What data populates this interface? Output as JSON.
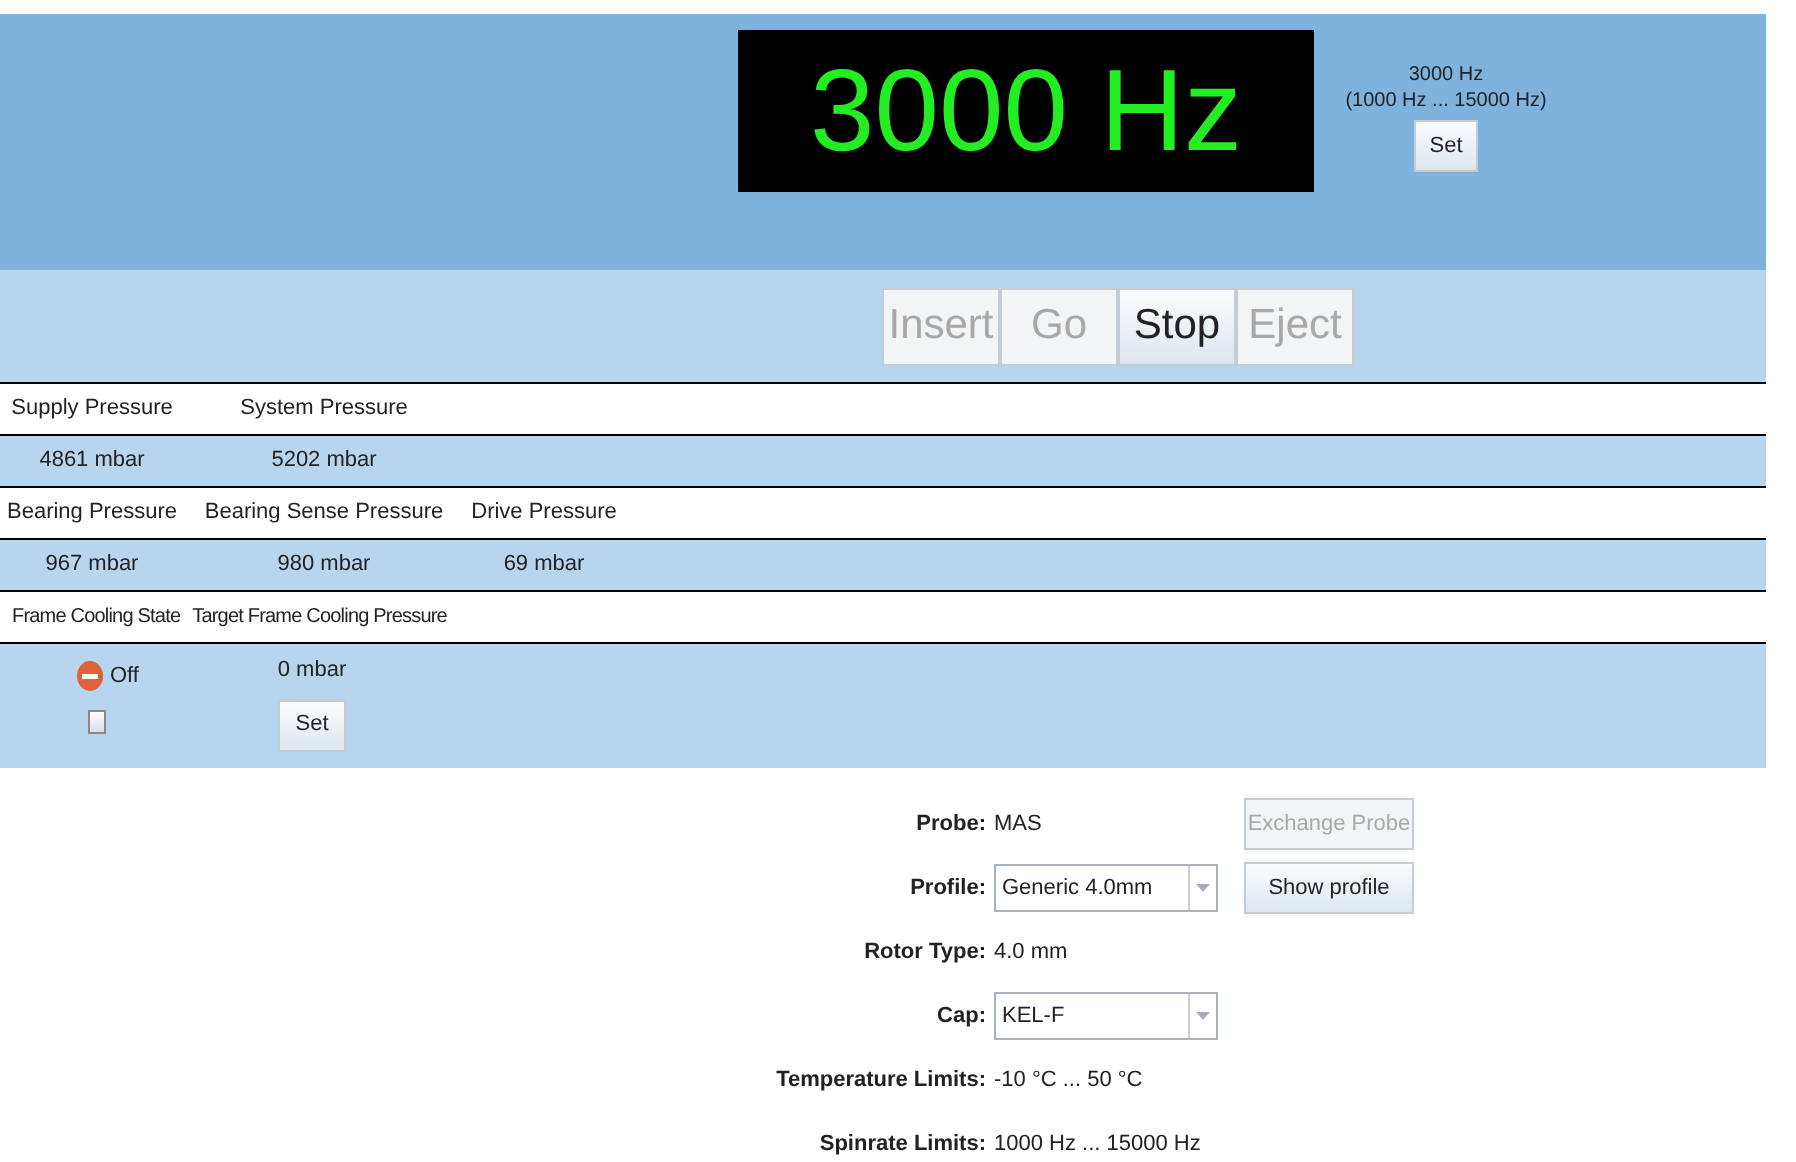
{
  "display": {
    "reading": "3000 Hz"
  },
  "setpoint": {
    "value": "3000 Hz",
    "range": "(1000 Hz ... 15000 Hz)",
    "button": "Set"
  },
  "controls": [
    {
      "label": "Insert",
      "disabled": true
    },
    {
      "label": "Go",
      "disabled": true
    },
    {
      "label": "Stop",
      "disabled": false
    },
    {
      "label": "Eject",
      "disabled": true
    }
  ],
  "pressure_groups": [
    {
      "columns": [
        {
          "header": "Supply Pressure",
          "value": "4861 mbar"
        },
        {
          "header": "System Pressure",
          "value": "5202 mbar"
        }
      ]
    },
    {
      "columns": [
        {
          "header": "Bearing Pressure",
          "value": "967 mbar"
        },
        {
          "header": "Bearing Sense Pressure",
          "value": "980 mbar"
        },
        {
          "header": "Drive Pressure",
          "value": "69 mbar"
        }
      ]
    }
  ],
  "frame_cooling": {
    "state_header": "Frame Cooling State",
    "target_header": "Target Frame Cooling Pressure",
    "on": false,
    "state_label": "Off",
    "checked": false,
    "target_value": "0 mbar",
    "button": "Set"
  },
  "probe_info": [
    {
      "kind": "text",
      "label": "Probe:",
      "value": "MAS",
      "button": {
        "label": "Exchange Probe",
        "disabled": true
      }
    },
    {
      "kind": "select",
      "label": "Profile:",
      "value": "Generic 4.0mm",
      "button": {
        "label": "Show profile",
        "disabled": false
      }
    },
    {
      "kind": "text",
      "label": "Rotor Type:",
      "value": "4.0 mm"
    },
    {
      "kind": "select",
      "label": "Cap:",
      "value": "KEL-F"
    },
    {
      "kind": "text",
      "label": "Temperature Limits:",
      "value": "-10 °C ... 50 °C"
    },
    {
      "kind": "text",
      "label": "Spinrate Limits:",
      "value": "1000 Hz ... 15000 Hz"
    }
  ]
}
